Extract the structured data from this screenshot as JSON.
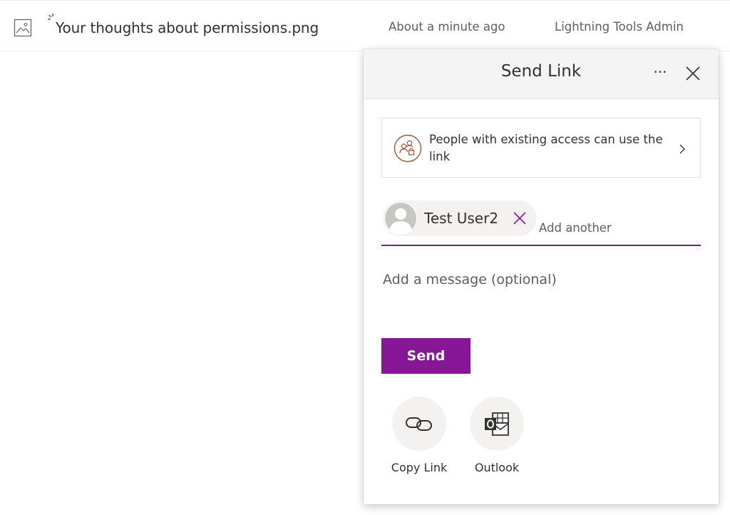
{
  "file": {
    "name": "Your thoughts about permissions.png",
    "modified": "About a minute ago",
    "author": "Lightning Tools Admin",
    "icon": "image-file-icon"
  },
  "dialog": {
    "title": "Send Link",
    "more_label": "···",
    "access_text": "People with existing access can use the link",
    "recipients": [
      {
        "name": "Test User2"
      }
    ],
    "add_another_placeholder": "Add another",
    "message_placeholder": "Add a message (optional)",
    "send_label": "Send",
    "actions": [
      {
        "label": "Copy Link",
        "icon": "link-icon"
      },
      {
        "label": "Outlook",
        "icon": "outlook-icon"
      }
    ]
  },
  "colors": {
    "accent": "#881798",
    "underline": "#7b1e86",
    "access_icon": "#a0522d",
    "header_bg": "#f4f4f4",
    "chip_bg": "#f3f2f1"
  }
}
